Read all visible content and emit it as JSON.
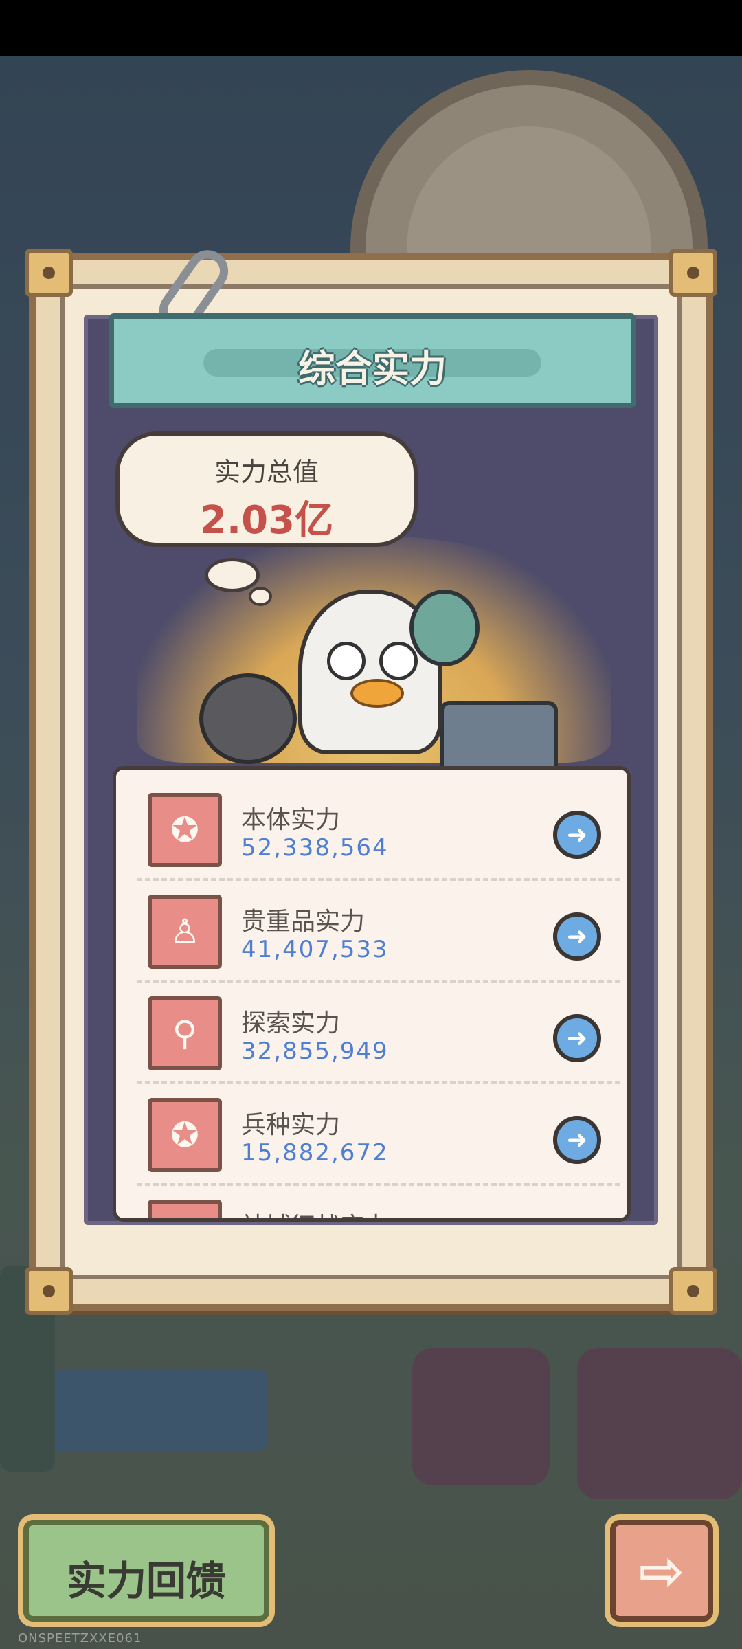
{
  "modal": {
    "title": "综合实力",
    "total": {
      "label": "实力总值",
      "value": "2.03亿"
    }
  },
  "list": {
    "items": [
      {
        "label": "本体实力",
        "value": "52,338,564",
        "icon": "duck-head-icon"
      },
      {
        "label": "贵重品实力",
        "value": "41,407,533",
        "icon": "bust-statue-icon"
      },
      {
        "label": "探索实力",
        "value": "32,855,949",
        "icon": "magnifier-icon"
      },
      {
        "label": "兵种实力",
        "value": "15,882,672",
        "icon": "duck-unit-icon"
      },
      {
        "label": "神域征战实力",
        "value": "",
        "icon": "partial-icon"
      }
    ]
  },
  "buttons": {
    "feedback_label": "实力回馈",
    "next_icon": "arrow-right-icon"
  },
  "watermark": "ONSPEETZXXE061",
  "colors": {
    "value_blue": "#4e7fd0",
    "total_red": "#c4524b",
    "banner_teal": "#8ccbc4",
    "icon_pink": "#e88d88"
  }
}
